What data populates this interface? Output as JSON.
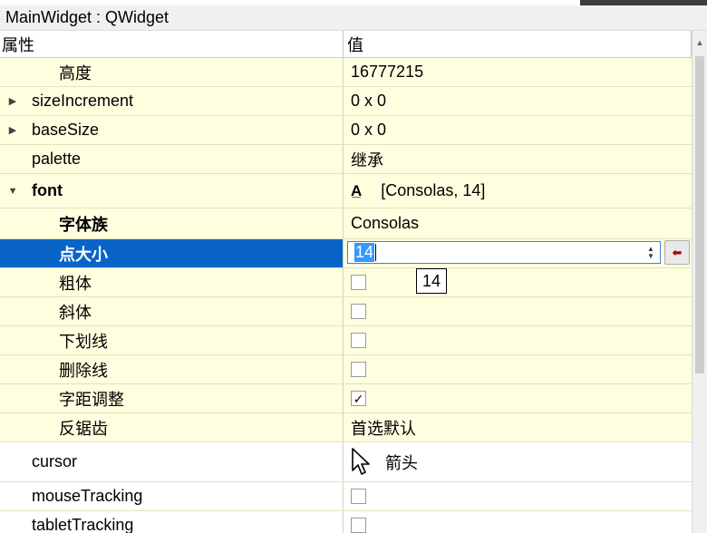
{
  "window": {
    "title": "MainWidget : QWidget"
  },
  "header": {
    "property": "属性",
    "value": "值"
  },
  "rows": [
    {
      "label": "高度",
      "value": "16777215"
    },
    {
      "label": "sizeIncrement",
      "value": "0 x 0",
      "expander": "collapsed"
    },
    {
      "label": "baseSize",
      "value": "0 x 0",
      "expander": "collapsed"
    },
    {
      "label": "palette",
      "value": "继承"
    },
    {
      "label": "font",
      "value": "[Consolas, 14]",
      "expander": "expanded",
      "icon": "font-icon"
    },
    {
      "label": "字体族",
      "value": "Consolas"
    },
    {
      "label": "点大小",
      "value": "14",
      "selected": true
    },
    {
      "label": "粗体",
      "checked": false
    },
    {
      "label": "斜体",
      "checked": false
    },
    {
      "label": "下划线",
      "checked": false
    },
    {
      "label": "删除线",
      "checked": false
    },
    {
      "label": "字距调整",
      "checked": true
    },
    {
      "label": "反锯齿",
      "value": "首选默认"
    },
    {
      "label": "cursor",
      "value": "箭头",
      "icon": "arrow-cursor-icon"
    },
    {
      "label": "mouseTracking",
      "checked": false
    },
    {
      "label": "tabletTracking",
      "checked": false
    }
  ],
  "tooltip": {
    "text": "14"
  },
  "colors": {
    "selection": "#0a64c8",
    "row_alt": "#ffffe0",
    "border": "#e2e2c0"
  }
}
